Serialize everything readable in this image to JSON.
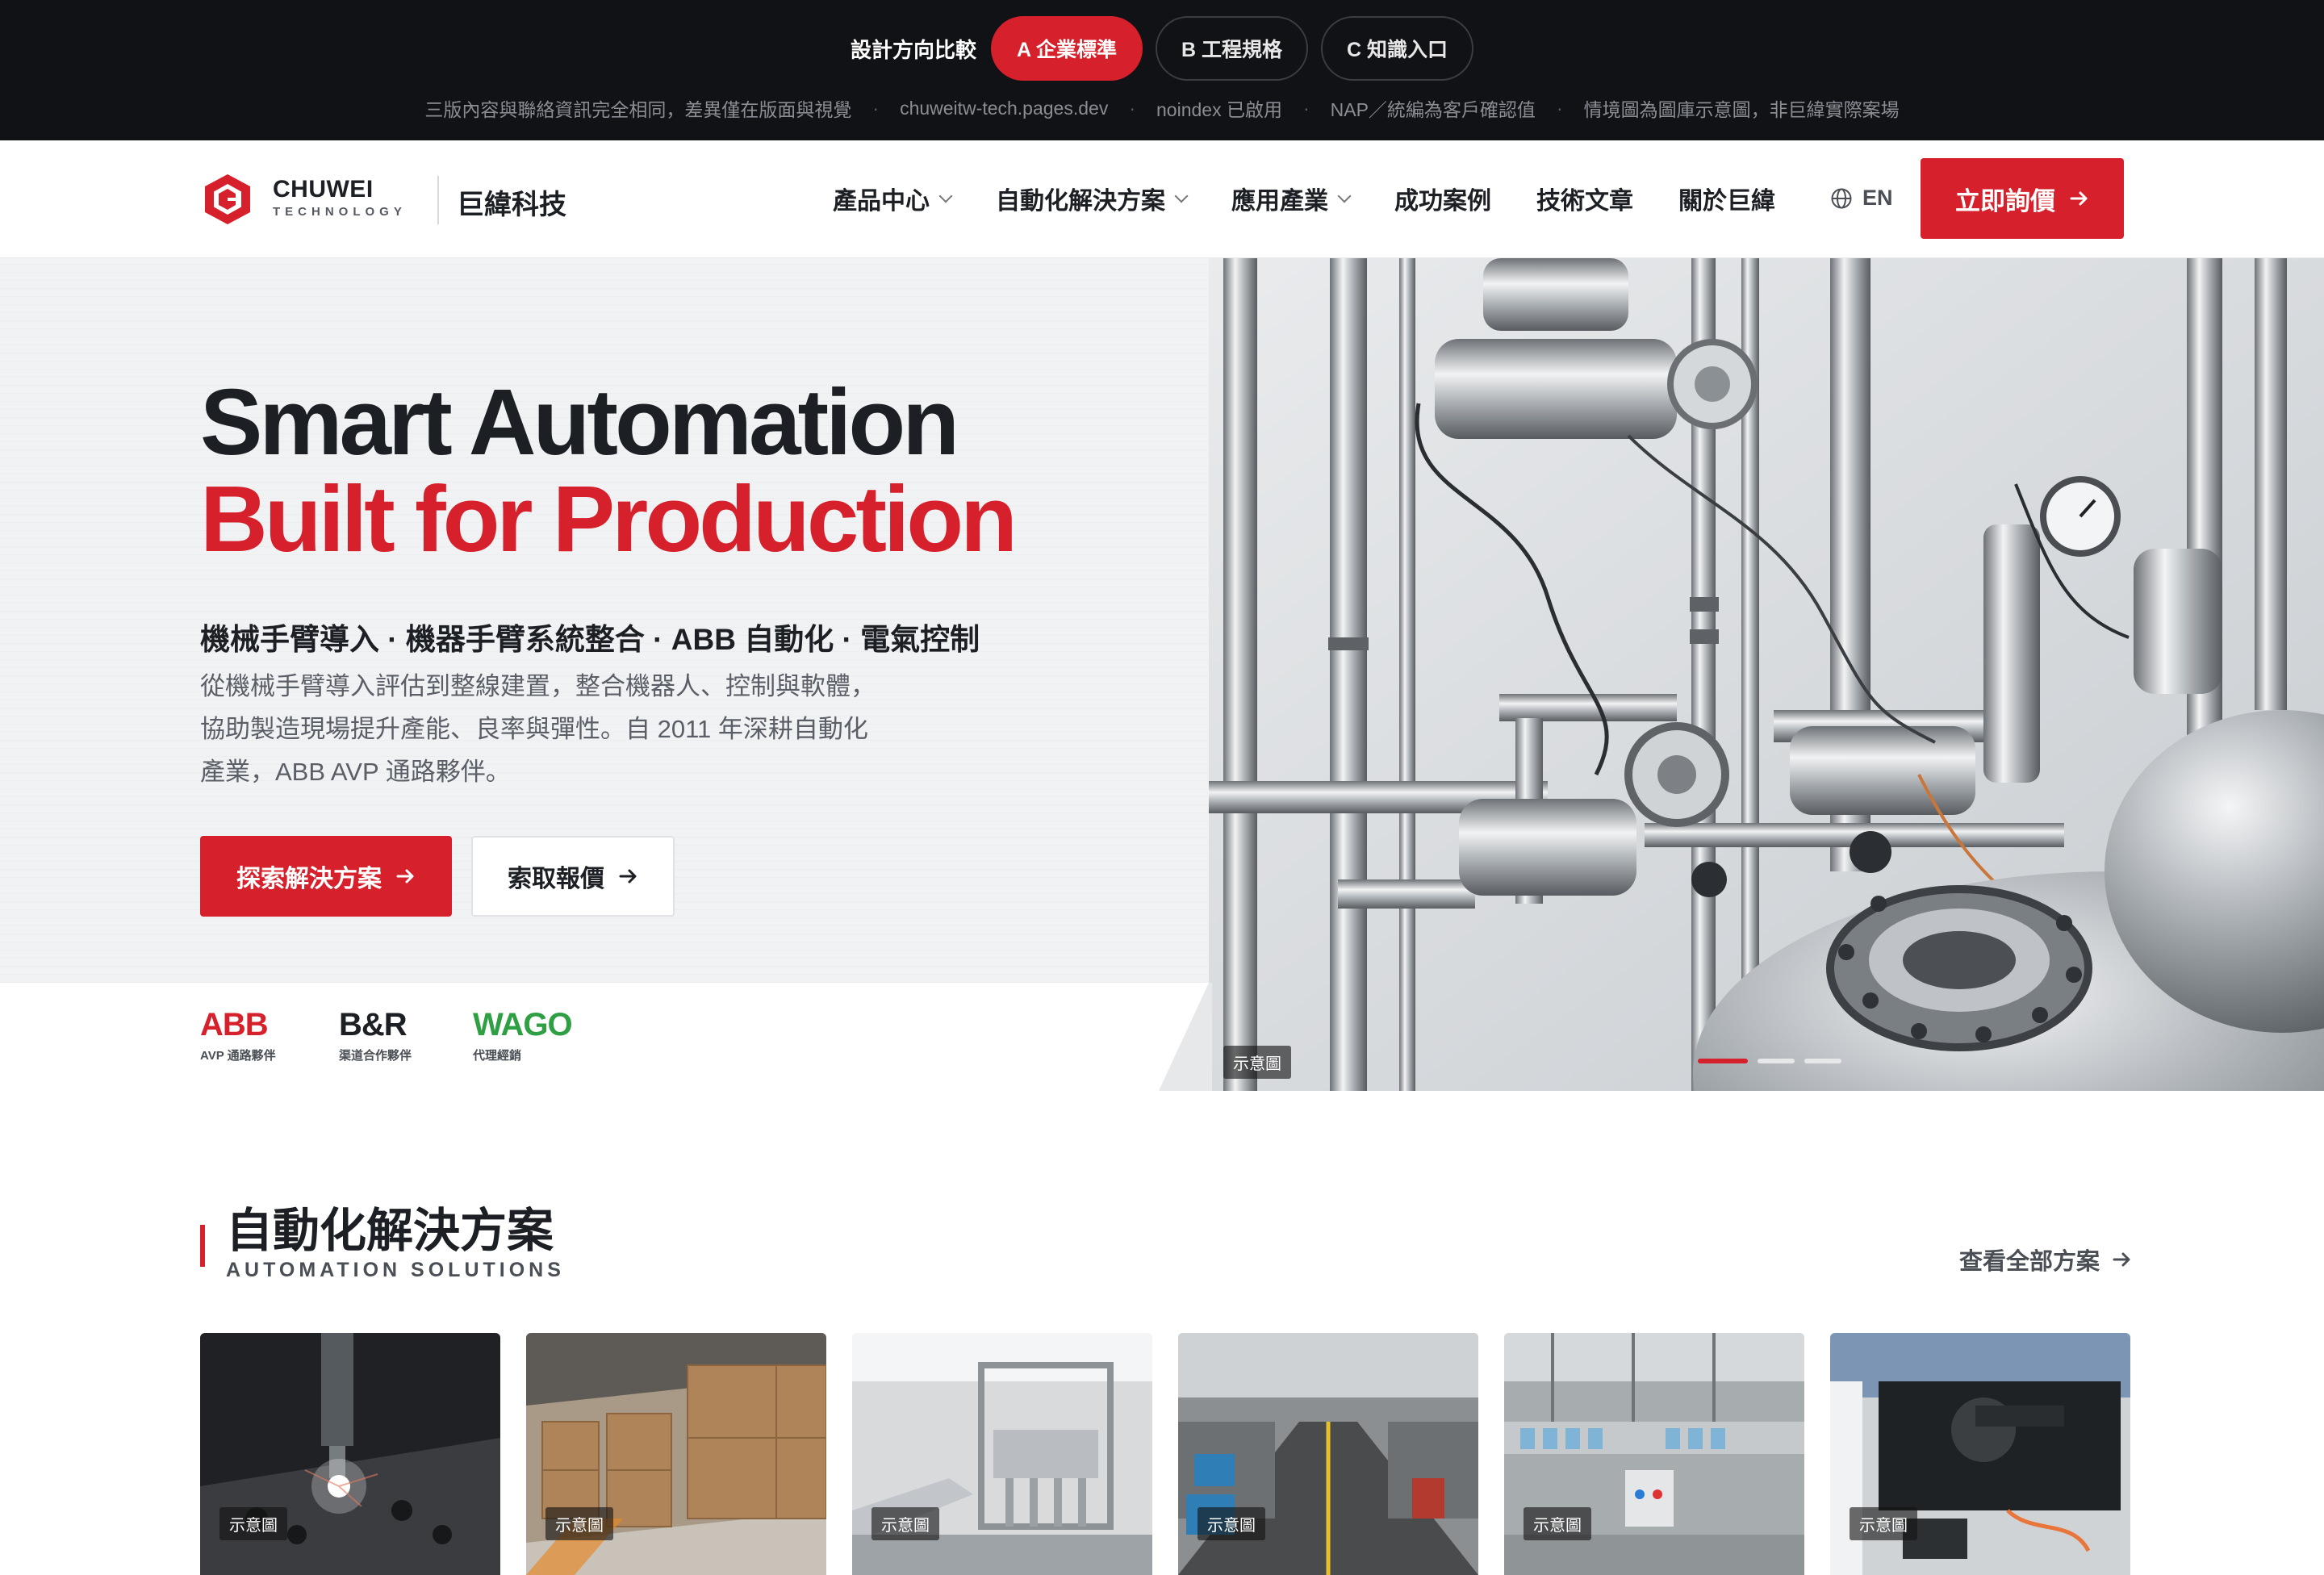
{
  "compare_bar": {
    "label": "設計方向比較",
    "options": [
      {
        "label": "A 企業標準",
        "active": true
      },
      {
        "label": "B 工程規格",
        "active": false
      },
      {
        "label": "C 知識入口",
        "active": false
      }
    ],
    "notes": [
      "三版內容與聯絡資訊完全相同，差異僅在版面與視覺",
      "chuweitw-tech.pages.dev",
      "noindex 已啟用",
      "NAP／統編為客戶確認值",
      "情境圖為圖庫示意圖，非巨緯實際案場"
    ],
    "separator": "·"
  },
  "header": {
    "brand_en": "CHUWEI",
    "brand_sub": "TECHNOLOGY",
    "brand_zh": "巨緯科技",
    "nav": [
      {
        "label": "產品中心",
        "dropdown": true
      },
      {
        "label": "自動化解決方案",
        "dropdown": true
      },
      {
        "label": "應用產業",
        "dropdown": true
      },
      {
        "label": "成功案例",
        "dropdown": false
      },
      {
        "label": "技術文章",
        "dropdown": false
      },
      {
        "label": "關於巨緯",
        "dropdown": false
      }
    ],
    "lang": "EN",
    "cta": "立即詢價"
  },
  "hero": {
    "title_line1": "Smart Automation",
    "title_line2": "Built for Production",
    "subtitle": "機械手臂導入 · 機器手臂系統整合 · ABB 自動化 · 電氣控制",
    "description": "從機械手臂導入評估到整線建置，整合機器人、控制與軟體，協助製造現場提升產能、良率與彈性。自 2011 年深耕自動化產業，ABB AVP 通路夥伴。",
    "btn_primary": "探索解決方案",
    "btn_secondary": "索取報價",
    "image_tag": "示意圖",
    "slides": 3,
    "active_slide": 0
  },
  "partners": [
    {
      "name": "ABB",
      "role": "AVP 通路夥伴",
      "color": "#d6202b"
    },
    {
      "name": "B&R",
      "role": "渠道合作夥伴",
      "color": "#1c1f24"
    },
    {
      "name": "WAGO",
      "role": "代理經銷",
      "color": "#2ea043"
    }
  ],
  "solutions": {
    "title": "自動化解決方案",
    "subtitle": "AUTOMATION SOLUTIONS",
    "see_all": "查看全部方案",
    "cards": [
      {
        "tag": "示意圖"
      },
      {
        "tag": "示意圖"
      },
      {
        "tag": "示意圖"
      },
      {
        "tag": "示意圖"
      },
      {
        "tag": "示意圖"
      },
      {
        "tag": "示意圖"
      }
    ]
  },
  "colors": {
    "accent": "#d6202b",
    "topbar_bg": "#101216",
    "text_dark": "#1c1f24"
  }
}
